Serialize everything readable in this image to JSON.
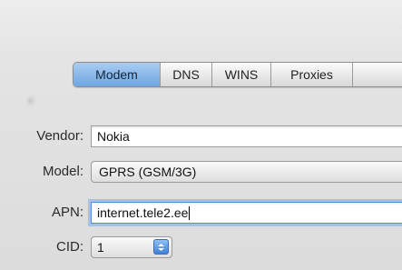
{
  "tabs": [
    {
      "label": "Modem",
      "active": true
    },
    {
      "label": "DNS",
      "active": false
    },
    {
      "label": "WINS",
      "active": false
    },
    {
      "label": "Proxies",
      "active": false
    },
    {
      "label": "",
      "active": false
    }
  ],
  "form": {
    "vendor": {
      "label": "Vendor:",
      "value": "Nokia"
    },
    "model": {
      "label": "Model:",
      "value": "GPRS (GSM/3G)"
    },
    "apn": {
      "label": "APN:",
      "value": "internet.tele2.ee"
    },
    "cid": {
      "label": "CID:",
      "value": "1"
    }
  },
  "colors": {
    "accent": "#6ea6e2",
    "focus_ring": "#78aaeb"
  },
  "icons": {
    "cid_stepper": "up-down-arrows-icon"
  }
}
